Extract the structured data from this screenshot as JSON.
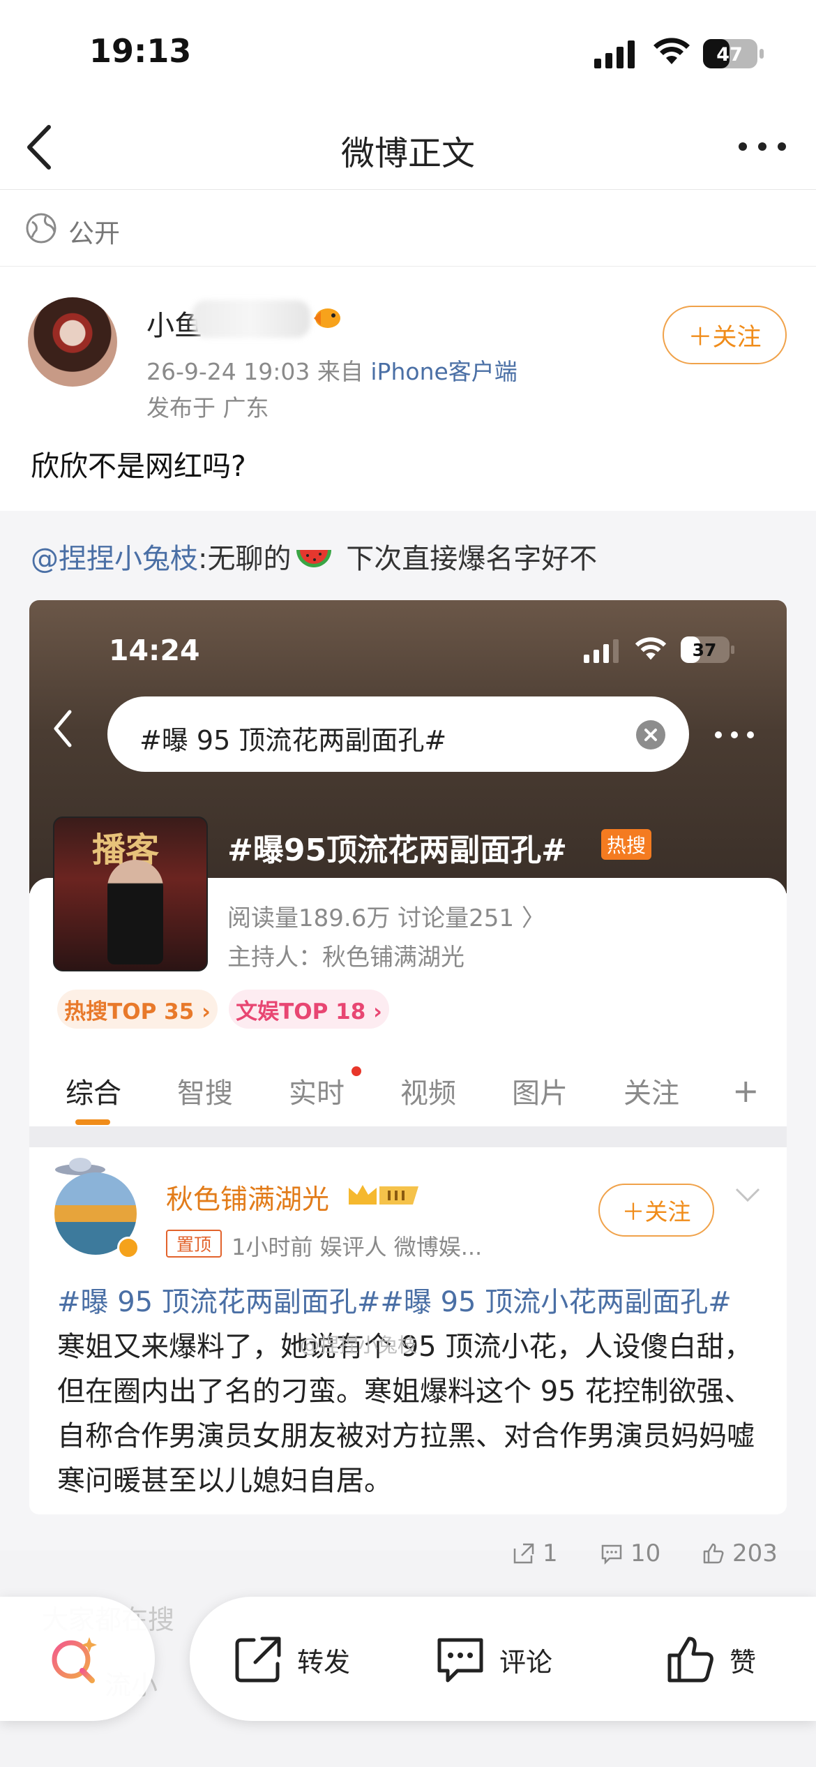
{
  "status_bar": {
    "time": "19:13",
    "battery": "47"
  },
  "nav": {
    "title": "微博正文"
  },
  "visibility": {
    "label": "公开"
  },
  "post": {
    "username": "小鱼",
    "meta_time": "26-9-24 19:03",
    "meta_from": "来自",
    "meta_client": "iPhone客户端",
    "location": "发布于 广东",
    "follow_label": "＋关注",
    "text": "欣欣不是网红吗?"
  },
  "repost": {
    "mention": "@捏捏小兔枝",
    "text_before": ":无聊的",
    "text_after": " 下次直接爆名字好不"
  },
  "embedded": {
    "time": "14:24",
    "battery": "37",
    "search_text": "#曝 95 顶流花两副面孔#",
    "cover_title": "播客",
    "topic": "#曝95顶流花两副面孔#",
    "hot_badge": "热搜",
    "stats": "阅读量189.6万  讨论量251  〉",
    "host": "主持人：秋色铺满湖光",
    "tag1": "热搜TOP 35 ›",
    "tag2": "文娱TOP 18 ›",
    "tabs": [
      "综合",
      "智搜",
      "实时",
      "视频",
      "图片",
      "关注"
    ],
    "plus": "+",
    "author": "秋色铺满湖光",
    "pin": "置顶",
    "post_meta": "1小时前   娱评人    微博娱...",
    "follow_label": "＋关注",
    "body_tags": "#曝 95 顶流花两副面孔##曝 95 顶流小花两副面孔#",
    "body": "寒姐又来爆料了，她说有个 95 顶流小花，人设傻白甜，但在圈内出了名的刁蛮。寒姐爆料这个 95 花控制欲强、自称合作男演员女朋友被对方拉黑、对合作男演员妈妈嘘寒问暖甚至以儿媳妇自居。",
    "watermark": "@捏捏小兔枝"
  },
  "counts": {
    "repost": "1",
    "comment": "10",
    "like": "203"
  },
  "bottom": {
    "repost_label": "转发",
    "comment_label": "评论",
    "like_label": "赞",
    "behind_text": "大家都在搜",
    "behind_text2": "流小"
  },
  "colors": {
    "accent": "#f08c1a",
    "link": "#4a6fa5",
    "hot": "#f47b20"
  }
}
